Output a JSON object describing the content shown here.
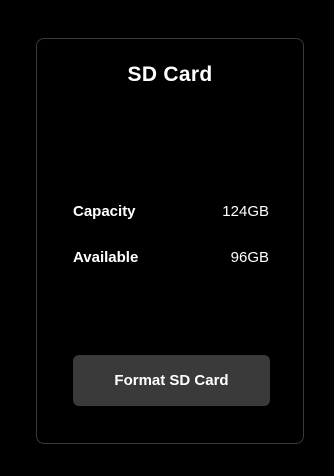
{
  "panel": {
    "title": "SD Card",
    "info": [
      {
        "label": "Capacity",
        "value": "124GB"
      },
      {
        "label": "Available",
        "value": "96GB"
      }
    ],
    "format_button_label": "Format SD Card"
  },
  "colors": {
    "background": "#000000",
    "panel_border": "#3a3a3a",
    "button_bg": "#3a3a3a",
    "text": "#ffffff"
  }
}
